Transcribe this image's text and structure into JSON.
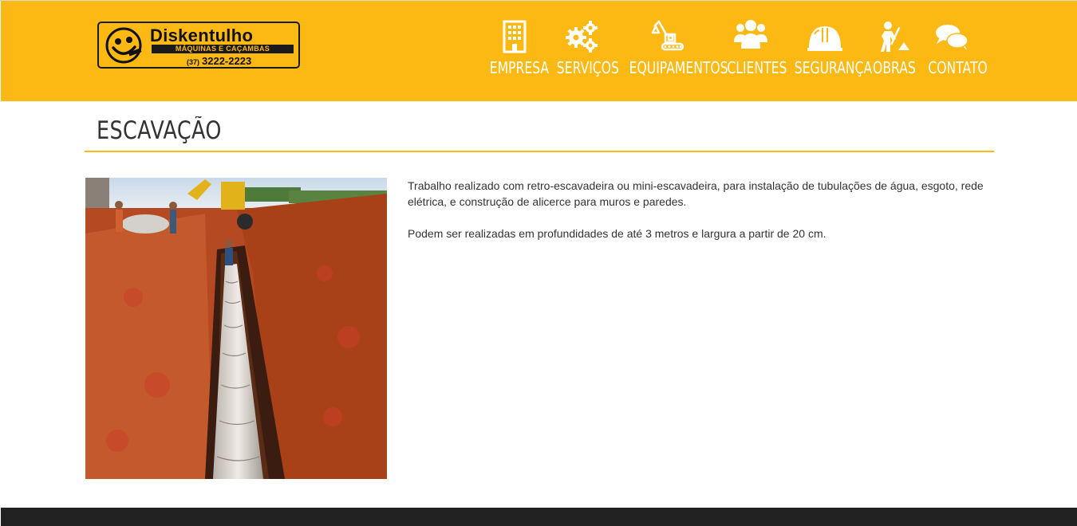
{
  "header": {
    "logo": {
      "brand": "Diskentulho",
      "tagline": "MÁQUINAS E CAÇAMBAS",
      "phone_area": "(37)",
      "phone_number": "3222-2223"
    },
    "nav": [
      {
        "label": "EMPRESA",
        "icon": "building-icon"
      },
      {
        "label": "SERVIÇOS",
        "icon": "gears-icon"
      },
      {
        "label": "EQUIPAMENTOS",
        "icon": "excavator-icon"
      },
      {
        "label": "CLIENTES",
        "icon": "users-icon"
      },
      {
        "label": "SEGURANÇA",
        "icon": "hard-hat-icon"
      },
      {
        "label": "OBRAS",
        "icon": "construction-worker-icon"
      },
      {
        "label": "CONTATO",
        "icon": "chat-bubbles-icon"
      }
    ]
  },
  "main": {
    "title": "ESCAVAÇÃO",
    "paragraphs": [
      "Trabalho realizado com retro-escavadeira ou mini-escavadeira, para instalação de tubulações de água, esgoto, rede elétrica, e construção de alicerce para muros e paredes.",
      "Podem ser realizadas em profundidades de até 3 metros e largura a partir de 20 cm."
    ]
  },
  "colors": {
    "accent": "#fdb913",
    "footer": "#222222",
    "text": "#333333"
  }
}
